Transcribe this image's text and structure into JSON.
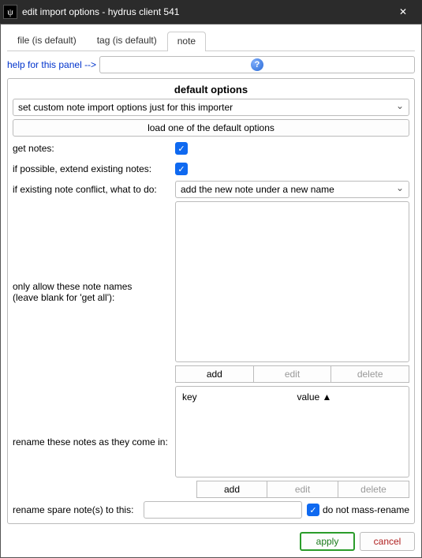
{
  "window": {
    "title": "edit import options - hydrus client 541",
    "app_glyph": "ψ",
    "close": "✕"
  },
  "tabs": {
    "file": "file (is default)",
    "tag": "tag (is default)",
    "note": "note"
  },
  "help": {
    "link": "help for this panel -->",
    "icon": "?"
  },
  "group": {
    "title": "default options",
    "mode_select": "set custom note import options just for this importer",
    "load_defaults_btn": "load one of the default options",
    "get_notes_label": "get notes:",
    "extend_label": "if possible, extend existing notes:",
    "conflict_label": "if existing note conflict, what to do:",
    "conflict_value": "add the new note under a new name",
    "allow_names_label_1": "only allow these note names",
    "allow_names_label_2": "(leave blank for 'get all'):",
    "rename_incoming_label": "rename these notes as they come in:",
    "rename_spare_label": "rename spare note(s) to this:",
    "no_mass_rename_label": "do not mass-rename",
    "col_key": "key",
    "col_value": "value ▲",
    "btn_add": "add",
    "btn_edit": "edit",
    "btn_delete": "delete"
  },
  "footer": {
    "apply": "apply",
    "cancel": "cancel"
  }
}
